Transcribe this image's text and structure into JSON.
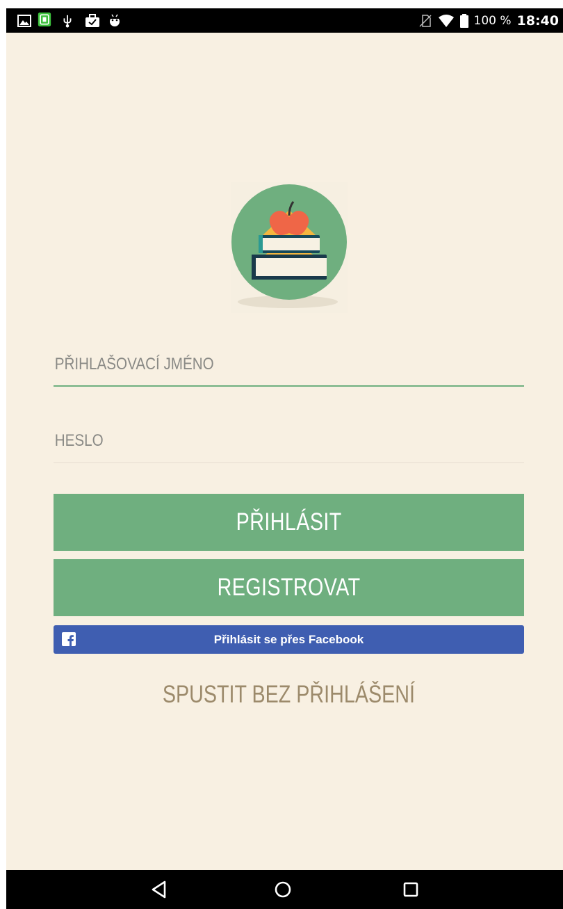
{
  "status_bar": {
    "left_icons": [
      "gallery-icon",
      "screen-app-icon",
      "usb-icon",
      "briefcase-icon",
      "android-icon"
    ],
    "right_icons": [
      "no-sim-icon",
      "wifi-icon",
      "battery-icon"
    ],
    "battery_text": "100 %",
    "time": "18:40"
  },
  "logo": {
    "icon": "books-apple-logo-icon"
  },
  "form": {
    "username_placeholder": "PŘIHLAŠOVACÍ JMÉNO",
    "username_value": "",
    "password_placeholder": "HESLO",
    "password_value": ""
  },
  "buttons": {
    "login_label": "PŘIHLÁSIT",
    "register_label": "REGISTROVAT",
    "facebook_label": "Přihlásit se přes Facebook",
    "skip_label": "SPUSTIT BEZ PŘIHLÁŠENÍ"
  },
  "nav_bar": {
    "back_icon": "back-triangle-icon",
    "home_icon": "home-circle-icon",
    "recents_icon": "recents-square-icon"
  },
  "colors": {
    "background": "#f8f0e2",
    "accent_green": "#6faf7f",
    "facebook_blue": "#3f5eb1",
    "skip_text": "#9c8a6b"
  }
}
